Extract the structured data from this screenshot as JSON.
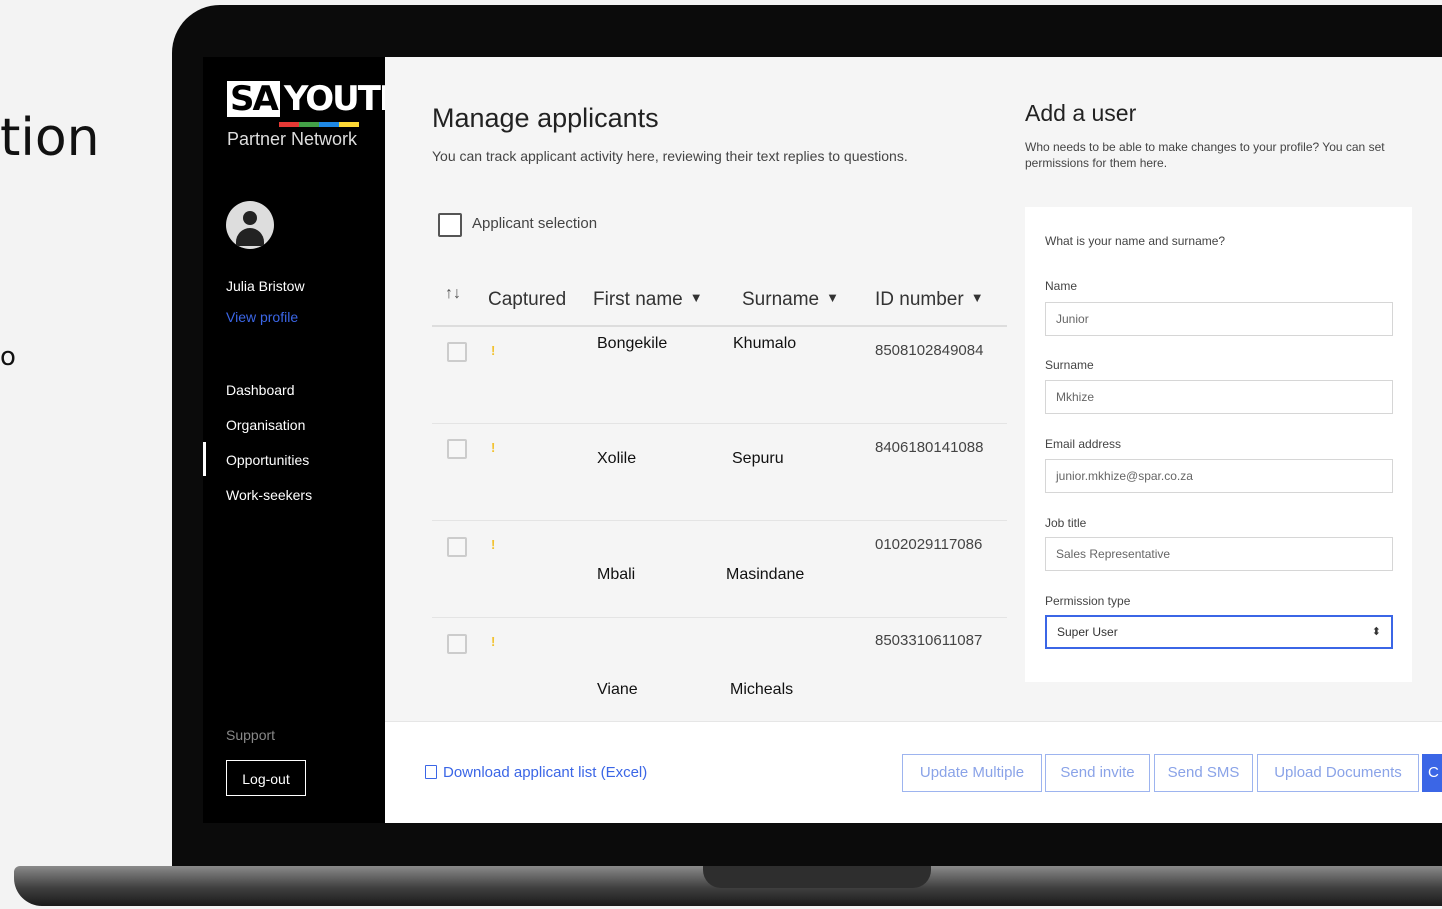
{
  "background": {
    "partial_text_1": "tion",
    "partial_text_2": "o"
  },
  "sidebar": {
    "logo": {
      "sa": "SA",
      "youth": "YOUTH",
      "sub": "Partner Network"
    },
    "user_name": "Julia Bristow",
    "view_profile": "View profile",
    "nav": [
      {
        "label": "Dashboard"
      },
      {
        "label": "Organisation"
      },
      {
        "label": "Opportunities"
      },
      {
        "label": "Work-seekers"
      }
    ],
    "active_nav": "Opportunities",
    "support": "Support",
    "logout": "Log-out"
  },
  "main": {
    "title": "Manage applicants",
    "subtitle": "You can track applicant activity here, reviewing their text replies to questions.",
    "applicant_selection": "Applicant selection",
    "table": {
      "sort_icon": "↑↓",
      "headers": {
        "captured": "Captured",
        "first_name": "First name",
        "surname": "Surname",
        "id_number": "ID number"
      },
      "caret": "▼",
      "flag": "!",
      "rows": [
        {
          "first_name": "Bongekile",
          "surname": "Khumalo",
          "id_number": "8508102849084"
        },
        {
          "first_name": "Xolile",
          "surname": "Sepuru",
          "id_number": "8406180141088"
        },
        {
          "first_name": "Mbali",
          "surname": "Masindane",
          "id_number": "0102029117086"
        },
        {
          "first_name": "Viane",
          "surname": "Micheals",
          "id_number": "8503310611087"
        }
      ]
    }
  },
  "add_user": {
    "title": "Add a user",
    "subtitle": "Who needs to be able to make changes to your profile? You can set permissions for them here.",
    "question": "What is your name and surname?",
    "fields": {
      "name": {
        "label": "Name",
        "value": "Junior"
      },
      "surname": {
        "label": "Surname",
        "value": "Mkhize"
      },
      "email": {
        "label": "Email address",
        "value": "junior.mkhize@spar.co.za"
      },
      "job_title": {
        "label": "Job title",
        "value": "Sales Representative"
      },
      "permission": {
        "label": "Permission type",
        "value": "Super User",
        "arrows": "⬍"
      }
    }
  },
  "footer": {
    "download": "Download applicant list (Excel)",
    "buttons": {
      "update_multiple": "Update Multiple",
      "send_invite": "Send invite",
      "send_sms": "Send SMS",
      "upload_documents": "Upload Documents",
      "primary": "C"
    }
  },
  "colors": {
    "accent": "#3b66e6",
    "sidebar_bg": "#000000",
    "flag": "#f2c230"
  }
}
